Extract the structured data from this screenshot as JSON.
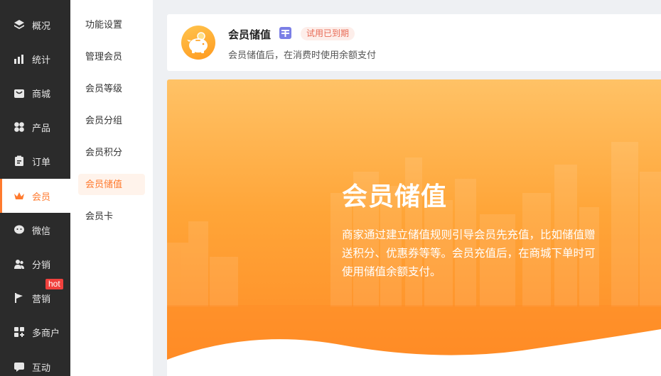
{
  "nav": {
    "items": [
      {
        "label": "概况",
        "icon": "layers-icon"
      },
      {
        "label": "统计",
        "icon": "chart-icon"
      },
      {
        "label": "商城",
        "icon": "shop-icon"
      },
      {
        "label": "产品",
        "icon": "grid-icon"
      },
      {
        "label": "订单",
        "icon": "clipboard-icon"
      },
      {
        "label": "会员",
        "icon": "crown-icon",
        "active": true
      },
      {
        "label": "微信",
        "icon": "wechat-icon"
      },
      {
        "label": "分销",
        "icon": "users-icon"
      },
      {
        "label": "营销",
        "icon": "flag-icon"
      },
      {
        "label": "多商户",
        "icon": "store-icon"
      },
      {
        "label": "互动",
        "icon": "chat-icon"
      }
    ],
    "hot_badge": "hot"
  },
  "subnav": {
    "items": [
      {
        "label": "功能设置"
      },
      {
        "label": "管理会员"
      },
      {
        "label": "会员等级"
      },
      {
        "label": "会员分组"
      },
      {
        "label": "会员积分"
      },
      {
        "label": "会员储值",
        "active": true
      },
      {
        "label": "会员卡"
      }
    ]
  },
  "header": {
    "title": "会员储值",
    "status": "试用已到期",
    "description": "会员储值后，在消费时使用余额支付"
  },
  "banner": {
    "title": "会员储值",
    "text": "商家通过建立储值规则引导会员先充值，比如储值赠送积分、优惠券等等。会员充值后，在商城下单时可使用储值余额支付。"
  },
  "colors": {
    "accent": "#ff7a2e",
    "nav_bg": "#2b2b2b",
    "hot": "#f0413d"
  }
}
